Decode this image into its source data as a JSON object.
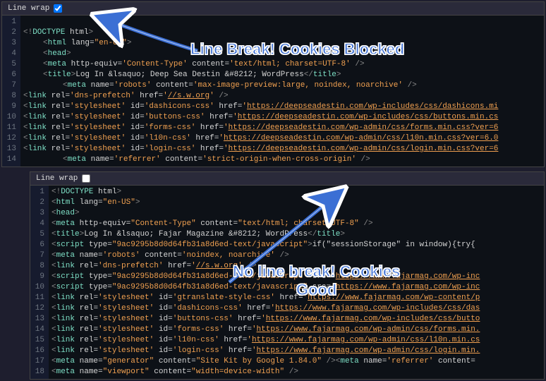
{
  "topPanel": {
    "lineWrapLabel": "Line wrap",
    "lineWrapChecked": true,
    "lineNumbers": [
      "1",
      "2",
      "3",
      "4",
      "5",
      "6",
      "7",
      "8",
      "9",
      "10",
      "11",
      "12",
      "13",
      "14"
    ],
    "lines": [
      {
        "indent": 0,
        "html": ""
      },
      {
        "indent": 0,
        "html": "<span class='punct'>&lt;!</span><span class='tag'>DOCTYPE</span> <span class='attr'>html</span><span class='punct'>&gt;</span>"
      },
      {
        "indent": 1,
        "html": "<span class='punct'>&lt;</span><span class='tag'>html</span> <span class='attr'>lang</span>=<span class='str'>\"en-US\"</span><span class='punct'>&gt;</span>"
      },
      {
        "indent": 1,
        "html": "<span class='punct'>&lt;</span><span class='tag'>head</span><span class='punct'>&gt;</span>"
      },
      {
        "indent": 1,
        "html": "<span class='punct'>&lt;</span><span class='tag'>meta</span> <span class='attr'>http-equiv</span>=<span class='str'>'Content-Type'</span> <span class='attr'>content</span>=<span class='str'>'text/html; charset=UTF-8'</span> <span class='punct'>/&gt;</span>"
      },
      {
        "indent": 1,
        "html": "<span class='punct'>&lt;</span><span class='tag'>title</span><span class='punct'>&gt;</span><span class='txt'>Log In &amp;lsaquo; Deep Sea Destin &amp;#8212; WordPress</span><span class='punct'>&lt;/</span><span class='tag'>title</span><span class='punct'>&gt;</span>"
      },
      {
        "indent": 2,
        "html": "<span class='punct'>&lt;</span><span class='tag'>meta</span> <span class='attr'>name</span>=<span class='str'>'robots'</span> <span class='attr'>content</span>=<span class='str'>'max-image-preview:large, noindex, noarchive'</span> <span class='punct'>/&gt;</span>"
      },
      {
        "indent": 0,
        "html": "<span class='punct'>&lt;</span><span class='tag'>link</span> <span class='attr'>rel</span>=<span class='str'>'dns-prefetch'</span> <span class='attr'>href</span>=<span class='str'>'</span><span class='url'>//s.w.org</span><span class='str'>'</span> <span class='punct'>/&gt;</span>"
      },
      {
        "indent": 0,
        "html": "<span class='punct'>&lt;</span><span class='tag'>link</span> <span class='attr'>rel</span>=<span class='str'>'stylesheet'</span> <span class='attr'>id</span>=<span class='str'>'dashicons-css'</span>  <span class='attr'>href</span>=<span class='str'>'</span><span class='url'>https://deepseadestin.com/wp-includes/css/dashicons.mi</span>"
      },
      {
        "indent": 0,
        "html": "<span class='punct'>&lt;</span><span class='tag'>link</span> <span class='attr'>rel</span>=<span class='str'>'stylesheet'</span> <span class='attr'>id</span>=<span class='str'>'buttons-css'</span>  <span class='attr'>href</span>=<span class='str'>'</span><span class='url'>https://deepseadestin.com/wp-includes/css/buttons.min.cs</span>"
      },
      {
        "indent": 0,
        "html": "<span class='punct'>&lt;</span><span class='tag'>link</span> <span class='attr'>rel</span>=<span class='str'>'stylesheet'</span> <span class='attr'>id</span>=<span class='str'>'forms-css'</span>  <span class='attr'>href</span>=<span class='str'>'</span><span class='url'>https://deepseadestin.com/wp-admin/css/forms.min.css?ver=6</span>"
      },
      {
        "indent": 0,
        "html": "<span class='punct'>&lt;</span><span class='tag'>link</span> <span class='attr'>rel</span>=<span class='str'>'stylesheet'</span> <span class='attr'>id</span>=<span class='str'>'l10n-css'</span>  <span class='attr'>href</span>=<span class='str'>'</span><span class='url'>https://deepseadestin.com/wp-admin/css/l10n.min.css?ver=6.0</span>"
      },
      {
        "indent": 0,
        "html": "<span class='punct'>&lt;</span><span class='tag'>link</span> <span class='attr'>rel</span>=<span class='str'>'stylesheet'</span> <span class='attr'>id</span>=<span class='str'>'login-css'</span>  <span class='attr'>href</span>=<span class='str'>'</span><span class='url'>https://deepseadestin.com/wp-admin/css/login.min.css?ver=6</span>"
      },
      {
        "indent": 2,
        "html": "<span class='punct'>&lt;</span><span class='tag'>meta</span> <span class='attr'>name</span>=<span class='str'>'referrer'</span> <span class='attr'>content</span>=<span class='str'>'strict-origin-when-cross-origin'</span> <span class='punct'>/&gt;</span>"
      }
    ]
  },
  "bottomPanel": {
    "lineWrapLabel": "Line wrap",
    "lineWrapChecked": false,
    "lineNumbers": [
      "1",
      "2",
      "3",
      "4",
      "5",
      "6",
      "7",
      "8",
      "9",
      "10",
      "11",
      "12",
      "13",
      "14",
      "15",
      "16",
      "17",
      "18"
    ],
    "lines": [
      {
        "indent": 0,
        "html": "<span class='punct'>&lt;!</span><span class='tag'>DOCTYPE</span> <span class='attr'>html</span><span class='punct'>&gt;</span>"
      },
      {
        "indent": 0,
        "html": "<span class='punct'>&lt;</span><span class='tag'>html</span> <span class='attr'>lang</span>=<span class='str'>\"en-US\"</span><span class='punct'>&gt;</span>"
      },
      {
        "indent": 0,
        "html": "<span class='punct'>&lt;</span><span class='tag'>head</span><span class='punct'>&gt;</span>"
      },
      {
        "indent": 0,
        "html": "<span class='punct'>&lt;</span><span class='tag'>meta</span> <span class='attr'>http-equiv</span>=<span class='str'>\"Content-Type\"</span> <span class='attr'>content</span>=<span class='str'>\"text/html; charset=UTF-8\"</span> <span class='punct'>/&gt;</span>"
      },
      {
        "indent": 0,
        "html": "<span class='punct'>&lt;</span><span class='tag'>title</span><span class='punct'>&gt;</span><span class='txt'>Log In &amp;lsaquo; Fajar Magazine &amp;#8212; WordPress</span><span class='punct'>&lt;/</span><span class='tag'>title</span><span class='punct'>&gt;</span>"
      },
      {
        "indent": 0,
        "html": "<span class='punct'>&lt;</span><span class='tag'>script</span> <span class='attr'>type</span>=<span class='str'>\"9ac9295b8d0d64fb31a8d6ed-text/javascript\"</span><span class='punct'>&gt;</span><span class='txt'>if(\"sessionStorage\" in window){try{</span>"
      },
      {
        "indent": 0,
        "html": "<span class='punct'>&lt;</span><span class='tag'>meta</span> <span class='attr'>name</span>=<span class='str'>'robots'</span> <span class='attr'>content</span>=<span class='str'>'noindex, noarchive'</span> <span class='punct'>/&gt;</span>"
      },
      {
        "indent": 0,
        "html": "<span class='punct'>&lt;</span><span class='tag'>link</span> <span class='attr'>rel</span>=<span class='str'>'dns-prefetch'</span> <span class='attr'>href</span>=<span class='str'>'</span><span class='url'>//s.w.org</span><span class='str'>'</span> <span class='punct'>/&gt;</span>"
      },
      {
        "indent": 0,
        "html": "<span class='punct'>&lt;</span><span class='tag'>script</span> <span class='attr'>type</span>=<span class='str'>\"9ac9295b8d0d64fb31a8d6ed-text/javascript\"</span> <span class='attr'>src</span>=<span class='str'>'</span><span class='url'>https://www.fajarmag.com/wp-inc</span>"
      },
      {
        "indent": 0,
        "html": "<span class='punct'>&lt;</span><span class='tag'>script</span> <span class='attr'>type</span>=<span class='str'>\"9ac9295b8d0d64fb31a8d6ed-text/javascript\"</span> <span class='attr'>src</span>=<span class='str'>'</span><span class='url'>https://www.fajarmag.com/wp-inc</span>"
      },
      {
        "indent": 0,
        "html": "<span class='punct'>&lt;</span><span class='tag'>link</span> <span class='attr'>rel</span>=<span class='str'>'stylesheet'</span> <span class='attr'>id</span>=<span class='str'>'gtranslate-style-css'</span>  <span class='attr'>href</span>=<span class='str'>'</span><span class='url'>https://www.fajarmag.com/wp-content/p</span>"
      },
      {
        "indent": 0,
        "html": "<span class='punct'>&lt;</span><span class='tag'>link</span> <span class='attr'>rel</span>=<span class='str'>'stylesheet'</span> <span class='attr'>id</span>=<span class='str'>'dashicons-css'</span>  <span class='attr'>href</span>=<span class='str'>'</span><span class='url'>https://www.fajarmag.com/wp-includes/css/das</span>"
      },
      {
        "indent": 0,
        "html": "<span class='punct'>&lt;</span><span class='tag'>link</span> <span class='attr'>rel</span>=<span class='str'>'stylesheet'</span> <span class='attr'>id</span>=<span class='str'>'buttons-css'</span>  <span class='attr'>href</span>=<span class='str'>'</span><span class='url'>https://www.fajarmag.com/wp-includes/css/butto</span>"
      },
      {
        "indent": 0,
        "html": "<span class='punct'>&lt;</span><span class='tag'>link</span> <span class='attr'>rel</span>=<span class='str'>'stylesheet'</span> <span class='attr'>id</span>=<span class='str'>'forms-css'</span>  <span class='attr'>href</span>=<span class='str'>'</span><span class='url'>https://www.fajarmag.com/wp-admin/css/forms.min.</span>"
      },
      {
        "indent": 0,
        "html": "<span class='punct'>&lt;</span><span class='tag'>link</span> <span class='attr'>rel</span>=<span class='str'>'stylesheet'</span> <span class='attr'>id</span>=<span class='str'>'l10n-css'</span>  <span class='attr'>href</span>=<span class='str'>'</span><span class='url'>https://www.fajarmag.com/wp-admin/css/l10n.min.cs</span>"
      },
      {
        "indent": 0,
        "html": "<span class='punct'>&lt;</span><span class='tag'>link</span> <span class='attr'>rel</span>=<span class='str'>'stylesheet'</span> <span class='attr'>id</span>=<span class='str'>'login-css'</span>  <span class='attr'>href</span>=<span class='str'>'</span><span class='url'>https://www.fajarmag.com/wp-admin/css/login.min.</span>"
      },
      {
        "indent": 0,
        "html": "<span class='punct'>&lt;</span><span class='tag'>meta</span> <span class='attr'>name</span>=<span class='str'>\"generator\"</span> <span class='attr'>content</span>=<span class='str'>\"Site Kit by Google 1.84.0\"</span> <span class='punct'>/&gt;</span><span class='punct'>&lt;</span><span class='tag'>meta</span> <span class='attr'>name</span>=<span class='str'>'referrer'</span> <span class='attr'>content</span>="
      },
      {
        "indent": 0,
        "html": "<span class='punct'>&lt;</span><span class='tag'>meta</span> <span class='attr'>name</span>=<span class='str'>\"viewport\"</span> <span class='attr'>content</span>=<span class='str'>\"width=device-width\"</span> <span class='punct'>/&gt;</span>"
      }
    ]
  },
  "annotations": {
    "top": "Line Break! Cookies Blocked",
    "bottomLine1": "No line break! Cookies",
    "bottomLine2": "Good"
  }
}
